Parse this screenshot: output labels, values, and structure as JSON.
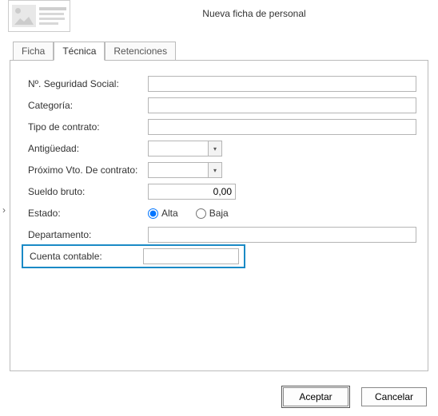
{
  "window": {
    "title": "Nueva ficha de personal"
  },
  "tabs": {
    "ficha": "Ficha",
    "tecnica": "Técnica",
    "retenciones": "Retenciones"
  },
  "labels": {
    "nss": "Nº. Seguridad Social:",
    "categoria": "Categoría:",
    "tipo_contrato": "Tipo de contrato:",
    "antiguedad": "Antigüedad:",
    "proximo_vto": "Próximo Vto. De contrato:",
    "sueldo_bruto": "Sueldo bruto:",
    "estado": "Estado:",
    "departamento": "Departamento:",
    "cuenta_contable": "Cuenta contable:"
  },
  "values": {
    "nss": "",
    "categoria": "",
    "tipo_contrato": "",
    "antiguedad": "",
    "proximo_vto": "",
    "sueldo_bruto": "0,00",
    "departamento": "",
    "cuenta_contable": ""
  },
  "estado": {
    "alta": "Alta",
    "baja": "Baja",
    "selected": "alta"
  },
  "buttons": {
    "accept": "Aceptar",
    "cancel": "Cancelar"
  },
  "icons": {
    "dropdown": "▾",
    "side": "›"
  }
}
